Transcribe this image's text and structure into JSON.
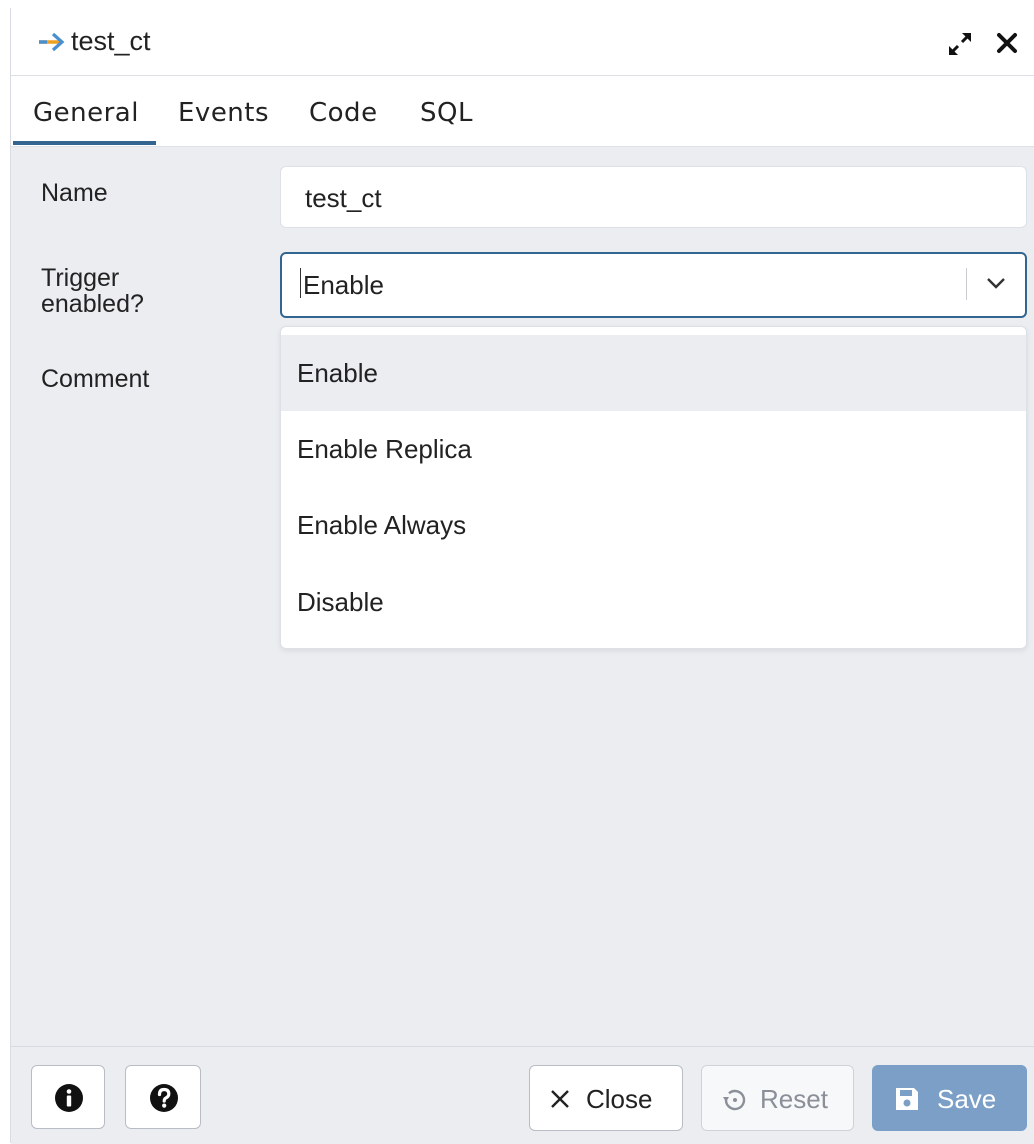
{
  "window": {
    "title": "test_ct",
    "title_icon": "arrow-right-icon",
    "expand_icon": "expand-icon",
    "close_icon": "close-icon"
  },
  "tabs": [
    {
      "label": "General",
      "active": true
    },
    {
      "label": "Events",
      "active": false
    },
    {
      "label": "Code",
      "active": false
    },
    {
      "label": "SQL",
      "active": false
    }
  ],
  "form": {
    "name_label": "Name",
    "name_value": "test_ct",
    "trigger_label_line1": "Trigger",
    "trigger_label_line2": "enabled?",
    "trigger_value": "Enable",
    "comment_label": "Comment"
  },
  "dropdown": {
    "options": [
      "Enable",
      "Enable Replica",
      "Enable Always",
      "Disable"
    ],
    "selected": "Enable"
  },
  "footer": {
    "info_icon": "info-icon",
    "help_icon": "help-icon",
    "close_label": "Close",
    "reset_label": "Reset",
    "save_label": "Save"
  },
  "colors": {
    "accent": "#326690",
    "title_arrow": "#f0a020",
    "save_bg": "#7b9fc6",
    "panel_bg": "#ebedf1"
  }
}
